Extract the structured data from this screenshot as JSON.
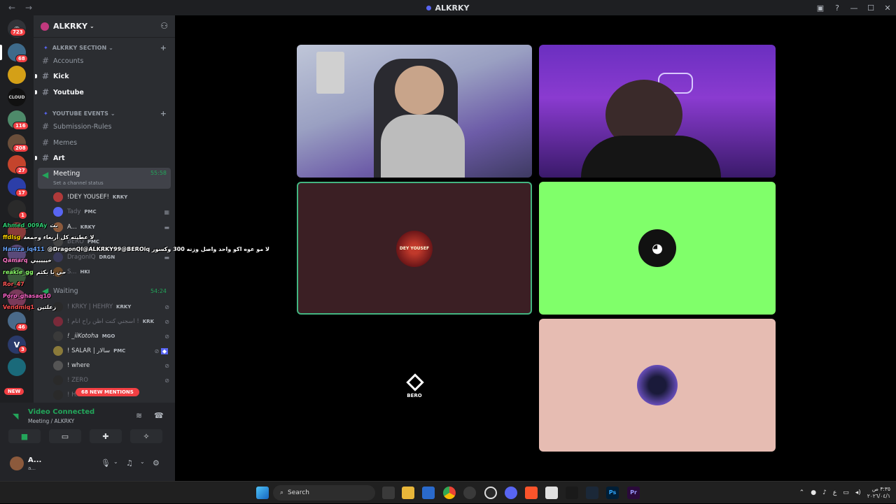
{
  "window": {
    "title": "ALKRKY"
  },
  "guilds": {
    "badges": [
      "723",
      "68",
      "116",
      "208",
      "27",
      "17",
      "1",
      "46",
      "3"
    ],
    "new_label": "NEW"
  },
  "server": {
    "name": "ALKRKY",
    "categories": [
      {
        "label": "ALKRKY SECTION"
      },
      {
        "label": "YOUTUBE EVENTS"
      }
    ],
    "channels": [
      {
        "label": "Accounts"
      },
      {
        "label": "Kick"
      },
      {
        "label": "Youtube"
      },
      {
        "label": "Submission-Rules"
      },
      {
        "label": "Memes"
      },
      {
        "label": "Art"
      }
    ],
    "meeting": {
      "label": "Meeting",
      "time": "55:58",
      "status": "Set a channel status"
    },
    "meeting_users": [
      {
        "name": "!DEY YOUSEF!",
        "tag": "KRKY"
      },
      {
        "name": "Tady",
        "tag": "PMC"
      },
      {
        "name": "A...",
        "tag": "KRKY"
      },
      {
        "name": "BERO",
        "tag": "PMC"
      },
      {
        "name": "DragonIQ",
        "tag": "DRGN"
      },
      {
        "name": "S...",
        "tag": "HKI"
      }
    ],
    "waiting": {
      "label": "Waiting",
      "time": "54:24"
    },
    "waiting_users": [
      {
        "name": "! KRKY | HEHRY",
        "tag": "KRKY"
      },
      {
        "name": "! اسجني كنت اظن راح انام !",
        "tag": "KRK"
      },
      {
        "name": "! _iiKotoha",
        "tag": "MGO"
      },
      {
        "name": "! SALAR | سالار",
        "tag": "PMC"
      },
      {
        "name": "! where",
        "tag": ""
      },
      {
        "name": "! ZERO",
        "tag": ""
      },
      {
        "name": "! H...",
        "tag": ""
      }
    ],
    "mentions_label": "68 NEW MENTIONS"
  },
  "voice_panel": {
    "status": "Video Connected",
    "location": "Meeting / ALKRKY"
  },
  "user_panel": {
    "name": "A...",
    "status": "a..."
  },
  "stage": {
    "tiles": [
      {
        "name": "stream-left-webcam"
      },
      {
        "name": "stream-right-webcam"
      },
      {
        "name": "dey-yousef-tile",
        "label": "DEY YOUSEF",
        "color": "#3b1f24",
        "border": "#43b581"
      },
      {
        "name": "discord-default-tile",
        "color": "#80ff6a"
      },
      {
        "name": "bero-tile",
        "label": "BERO"
      },
      {
        "name": "anime-avatar-tile",
        "color": "#e6bcb2"
      }
    ]
  },
  "chat_overlay": [
    {
      "user": "Ahmed_009Ay",
      "text": "بت",
      "color": "#2ecc71"
    },
    {
      "user": "ffdlsg",
      "text": "ﻻ عطيته كل أربعاء وجمعة",
      "color": "#ffd400"
    },
    {
      "user": "Hamza_iq411",
      "text": "@DragonQI@ALKRKY99@BEROiq لا مو عوه اكو واحد واصل وزنه 300 وكسور",
      "color": "#6aa7ff"
    },
    {
      "user": "Qamarq",
      "text": "خيييييي",
      "color": "#ff77c8"
    },
    {
      "user": "reakle_gg",
      "text": "حي با بكثم",
      "color": "#8cff6a"
    },
    {
      "user": "Ror_47",
      "text": "",
      "color": "#ff5555"
    },
    {
      "user": "Poro_ghasaq10",
      "text": "",
      "color": "#ff66cc"
    },
    {
      "user": "Vendmiq1",
      "text": "زعلتين",
      "color": "#ff4f4f"
    }
  ],
  "taskbar": {
    "search_label": "Search",
    "tray_lang": "ع",
    "clock_time": "٣:٣٥ ص",
    "clock_date": "٢٠٢٦/٠٤/١"
  }
}
